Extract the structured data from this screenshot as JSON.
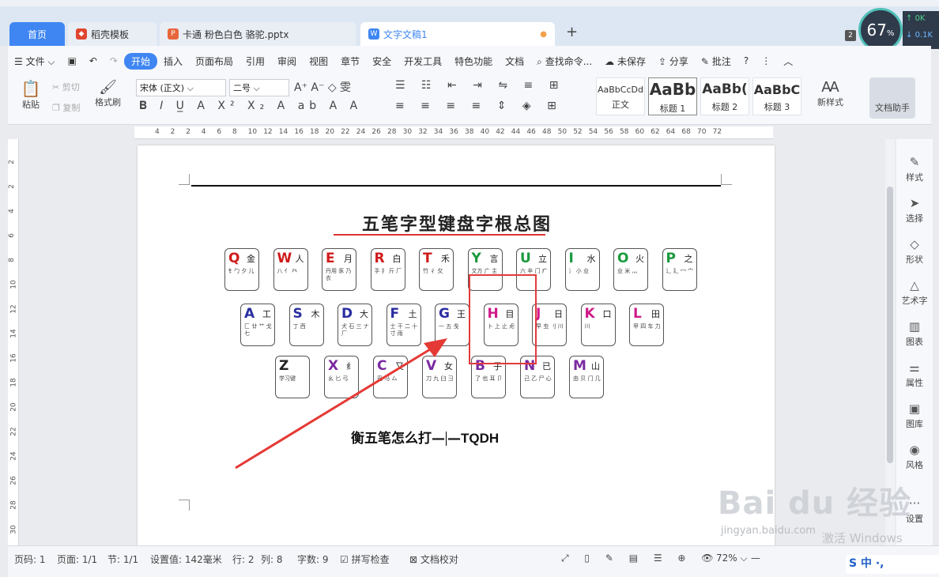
{
  "tabs": {
    "home": "首页",
    "template": "稻壳模板",
    "ppt": "卡通 粉色白色 骆驼.pptx",
    "doc": "文字文稿1",
    "badge": "2"
  },
  "perf": {
    "cpu": "67",
    "unit": "%",
    "up": "0K",
    "down": "0.1K"
  },
  "menu": {
    "file": "文件",
    "items": [
      "开始",
      "插入",
      "页面布局",
      "引用",
      "审阅",
      "视图",
      "章节",
      "安全",
      "开发工具",
      "特色功能",
      "文档"
    ],
    "search": "查找命令...",
    "unsaved": "未保存",
    "share": "分享",
    "comment": "批注"
  },
  "toolbar": {
    "paste": "粘贴",
    "cut": "剪切",
    "copy": "复制",
    "format_painter": "格式刷",
    "font": "宋体 (正文)",
    "size": "二号",
    "new_style": "新样式",
    "doc_helper": "文档助手"
  },
  "styles": [
    {
      "sample": "AaBbCcDd",
      "name": "正文"
    },
    {
      "sample": "AaBb",
      "name": "标题 1"
    },
    {
      "sample": "AaBb(",
      "name": "标题 2"
    },
    {
      "sample": "AaBbC",
      "name": "标题 3"
    }
  ],
  "ruler": {
    "h": [
      "4",
      "2",
      "2",
      "4",
      "6",
      "8",
      "10",
      "12",
      "14",
      "16",
      "18",
      "20",
      "22",
      "24",
      "26",
      "28",
      "30",
      "32",
      "34",
      "36",
      "38",
      "40",
      "42",
      "44",
      "46",
      "48",
      "50",
      "52",
      "54",
      "56",
      "58",
      "60",
      "62",
      "64",
      "68",
      "70",
      "72"
    ],
    "v": [
      "2",
      "2",
      "4",
      "6",
      "8",
      "10",
      "12",
      "14",
      "16",
      "18",
      "20",
      "22",
      "24",
      "26",
      "28",
      "30"
    ]
  },
  "keyboard": {
    "title": "五笔字型键盘字根总图",
    "row1": [
      {
        "k": "Q",
        "c": "金",
        "color": "#d01a1a",
        "sub": "钅勹 夕 儿"
      },
      {
        "k": "W",
        "c": "人",
        "color": "#d01a1a",
        "sub": "八 亻 癶"
      },
      {
        "k": "E",
        "c": "月",
        "color": "#d01a1a",
        "sub": "丹用 豕 乃 衣"
      },
      {
        "k": "R",
        "c": "白",
        "color": "#d01a1a",
        "sub": "手 扌 斤 厂"
      },
      {
        "k": "T",
        "c": "禾",
        "color": "#d01a1a",
        "sub": "竹 彳 攵"
      },
      {
        "k": "Y",
        "c": "言",
        "color": "#1b9a3e",
        "sub": "文方 广 主"
      },
      {
        "k": "U",
        "c": "立",
        "color": "#1b9a3e",
        "sub": "六 辛 门 疒"
      },
      {
        "k": "I",
        "c": "水",
        "color": "#1b9a3e",
        "sub": "氵 小 业"
      },
      {
        "k": "O",
        "c": "火",
        "color": "#1b9a3e",
        "sub": "业 米 灬"
      },
      {
        "k": "P",
        "c": "之",
        "color": "#1b9a3e",
        "sub": "辶 廴 冖 宀"
      }
    ],
    "row2": [
      {
        "k": "A",
        "c": "工",
        "color": "#2a2ea0",
        "sub": "匚 廿 艹 戈 七"
      },
      {
        "k": "S",
        "c": "木",
        "color": "#2a2ea0",
        "sub": "丁 西"
      },
      {
        "k": "D",
        "c": "大",
        "color": "#2a2ea0",
        "sub": "犬 石 三 ナ 厂"
      },
      {
        "k": "F",
        "c": "土",
        "color": "#2a2ea0",
        "sub": "士 干 二 十 寸 雨"
      },
      {
        "k": "G",
        "c": "王",
        "color": "#2a2ea0",
        "sub": "一 五 戋"
      },
      {
        "k": "H",
        "c": "目",
        "color": "#d01a8a",
        "sub": "卜 上 止 虍"
      },
      {
        "k": "J",
        "c": "日",
        "color": "#d01a8a",
        "sub": "早 虫 刂 川"
      },
      {
        "k": "K",
        "c": "口",
        "color": "#d01a8a",
        "sub": "川"
      },
      {
        "k": "L",
        "c": "田",
        "color": "#d01a8a",
        "sub": "甲 四 车 力"
      }
    ],
    "row3": [
      {
        "k": "Z",
        "c": "",
        "color": "#222",
        "sub": "学习键"
      },
      {
        "k": "X",
        "c": "纟",
        "color": "#7a2aa0",
        "sub": "幺 匕 弓"
      },
      {
        "k": "C",
        "c": "又",
        "color": "#7a2aa0",
        "sub": "巴 马 厶"
      },
      {
        "k": "V",
        "c": "女",
        "color": "#7a2aa0",
        "sub": "刀 九 臼 彐"
      },
      {
        "k": "B",
        "c": "子",
        "color": "#7a2aa0",
        "sub": "了 也 耳 卩"
      },
      {
        "k": "N",
        "c": "已",
        "color": "#7a2aa0",
        "sub": "己 乙 尸 心"
      },
      {
        "k": "M",
        "c": "山",
        "color": "#7a2aa0",
        "sub": "由 贝 门 几"
      }
    ]
  },
  "caption": {
    "pre": "衡五笔怎么打",
    "post": "TQDH"
  },
  "right_panel": [
    "样式",
    "选择",
    "形状",
    "艺术字",
    "图表",
    "属性",
    "图库",
    "风格",
    "设置"
  ],
  "status": {
    "page_num": "页码: 1",
    "pages": "页面: 1/1",
    "section": "节: 1/1",
    "setting": "设置值: 142毫米",
    "row": "行: 2",
    "col": "列: 8",
    "words": "字数: 9",
    "spell": "拼写检查",
    "proof": "文档校对",
    "zoom": "72%"
  },
  "watermark": {
    "main": "Bai du 经验",
    "sub": "jingyan.baidu.com",
    "win": "激活 Windows"
  },
  "ime": "S 中 ·,"
}
